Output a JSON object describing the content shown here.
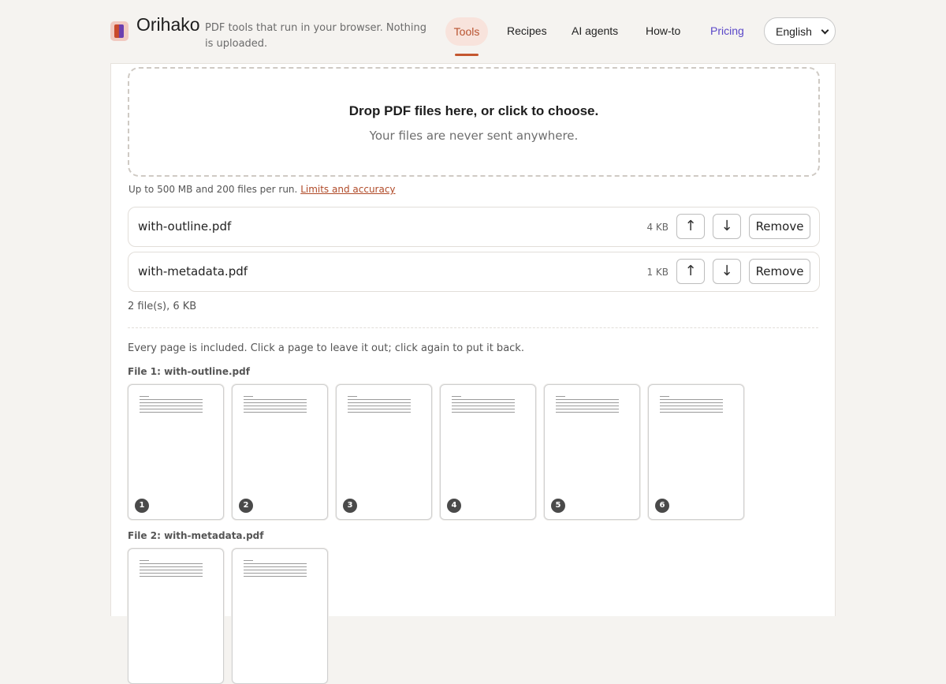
{
  "header": {
    "brand": "Orihako",
    "tagline": "PDF tools that run in your browser. Nothing is uploaded.",
    "nav": [
      "Tools",
      "Recipes",
      "AI agents",
      "How-to",
      "Pricing"
    ],
    "language": "English"
  },
  "dropzone": {
    "title": "Drop PDF files here, or click to choose.",
    "subtitle": "Your files are never sent anywhere."
  },
  "limits": {
    "text": "Up to 500 MB and 200 files per run.",
    "link": "Limits and accuracy"
  },
  "files": [
    {
      "name": "with-outline.pdf",
      "size": "4 KB",
      "up": "↑",
      "down": "↓",
      "remove": "Remove"
    },
    {
      "name": "with-metadata.pdf",
      "size": "1 KB",
      "up": "↑",
      "down": "↓",
      "remove": "Remove"
    }
  ],
  "summary": "2 file(s), 6 KB",
  "hint": "Every page is included. Click a page to leave it out; click again to put it back.",
  "groups": [
    {
      "label": "File 1: with-outline.pdf",
      "pages": [
        "1",
        "2",
        "3",
        "4",
        "5",
        "6"
      ]
    },
    {
      "label": "File 2: with-metadata.pdf",
      "pages": [
        "",
        ""
      ]
    }
  ],
  "colors": {
    "accent": "#c4562f",
    "pricing": "#5a47c8"
  }
}
